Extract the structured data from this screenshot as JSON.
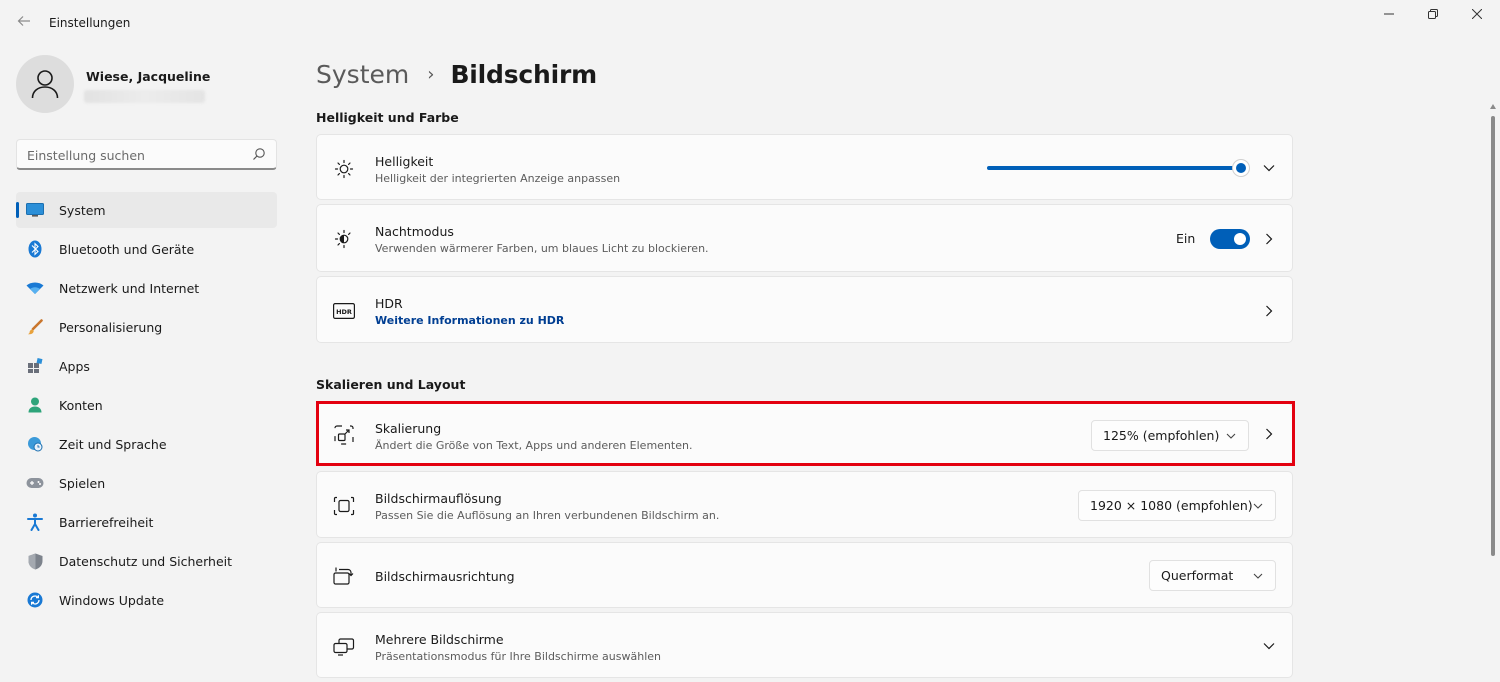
{
  "window": {
    "title": "Einstellungen",
    "back_icon": "arrow-left-icon",
    "controls": [
      "minimize-icon",
      "restore-icon",
      "close-icon"
    ]
  },
  "profile": {
    "name": "Wiese, Jacqueline",
    "avatar_icon": "person-icon"
  },
  "search": {
    "placeholder": "Einstellung suchen",
    "icon": "search-icon"
  },
  "sidebar": {
    "items": [
      {
        "label": "System",
        "icon": "display-icon",
        "active": true
      },
      {
        "label": "Bluetooth und Geräte",
        "icon": "bluetooth-icon"
      },
      {
        "label": "Netzwerk und Internet",
        "icon": "wifi-icon"
      },
      {
        "label": "Personalisierung",
        "icon": "brush-icon"
      },
      {
        "label": "Apps",
        "icon": "apps-icon"
      },
      {
        "label": "Konten",
        "icon": "account-icon"
      },
      {
        "label": "Zeit und Sprache",
        "icon": "globe-clock-icon"
      },
      {
        "label": "Spielen",
        "icon": "gamepad-icon"
      },
      {
        "label": "Barrierefreiheit",
        "icon": "accessibility-icon"
      },
      {
        "label": "Datenschutz und Sicherheit",
        "icon": "shield-icon"
      },
      {
        "label": "Windows Update",
        "icon": "update-icon"
      }
    ]
  },
  "breadcrumb": {
    "parent": "System",
    "separator": "›",
    "current": "Bildschirm"
  },
  "sections": {
    "brightness_color": "Helligkeit und Farbe",
    "scale_layout": "Skalieren und Layout"
  },
  "cards": {
    "brightness": {
      "title": "Helligkeit",
      "subtitle": "Helligkeit der integrierten Anzeige anpassen",
      "icon": "sun-icon",
      "value_percent": 100
    },
    "night_mode": {
      "title": "Nachtmodus",
      "subtitle": "Verwenden wärmerer Farben, um blaues Licht zu blockieren.",
      "icon": "night-mode-icon",
      "toggle_label": "Ein",
      "toggle_on": true
    },
    "hdr": {
      "title": "HDR",
      "link": "Weitere Informationen zu HDR",
      "icon": "hdr-icon"
    },
    "scaling": {
      "title": "Skalierung",
      "subtitle": "Ändert die Größe von Text, Apps und anderen Elementen.",
      "icon": "scale-icon",
      "value": "125% (empfohlen)"
    },
    "resolution": {
      "title": "Bildschirmauflösung",
      "subtitle": "Passen Sie die Auflösung an Ihren verbundenen Bildschirm an.",
      "icon": "resolution-icon",
      "value": "1920 × 1080 (empfohlen)"
    },
    "orientation": {
      "title": "Bildschirmausrichtung",
      "icon": "orientation-icon",
      "value": "Querformat"
    },
    "multiple": {
      "title": "Mehrere Bildschirme",
      "subtitle": "Präsentationsmodus für Ihre Bildschirme auswählen",
      "icon": "multiple-displays-icon"
    }
  },
  "colors": {
    "accent": "#005fb8",
    "highlight": "#e3000f",
    "background": "#f3f3f3",
    "card": "#fbfbfb"
  }
}
